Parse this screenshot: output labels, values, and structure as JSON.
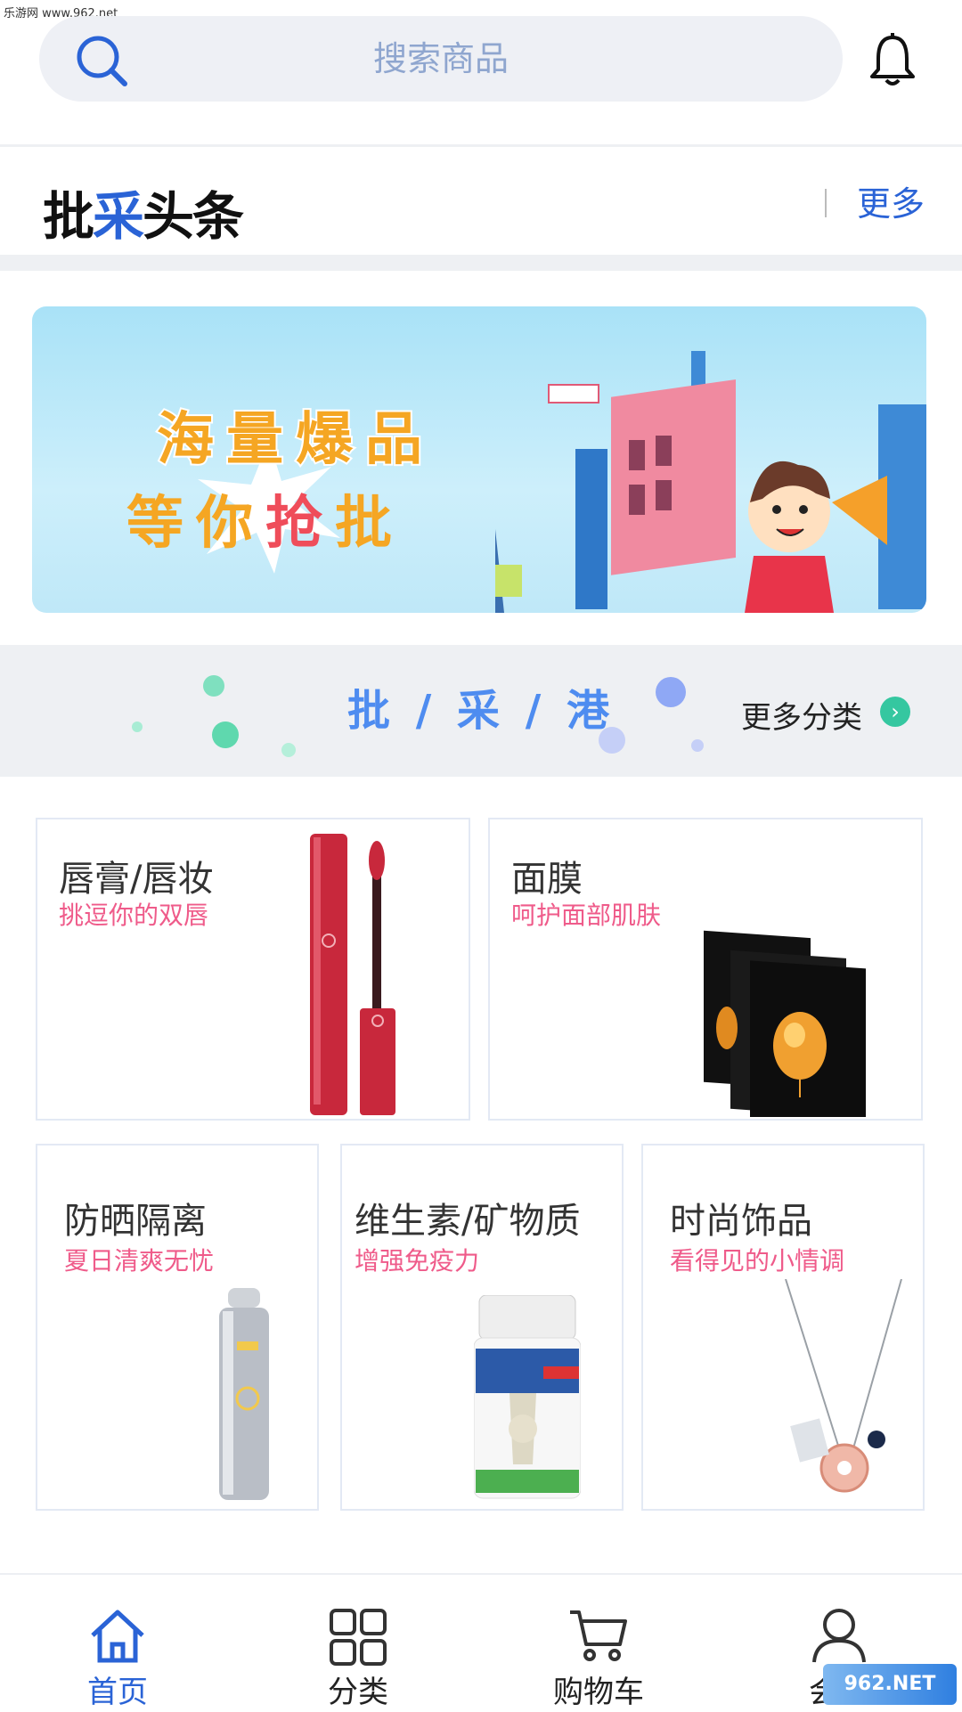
{
  "watermark_top": "乐游网 www.962.net",
  "search": {
    "placeholder": "搜索商品"
  },
  "headline": {
    "part1": "批",
    "part2": "采",
    "part3": "头条",
    "more": "更多"
  },
  "banner": {
    "line1": "海量爆品",
    "line2a": "等你",
    "line2b": "抢",
    "line2c": "批"
  },
  "category_strip": {
    "title": "批 / 采 / 港",
    "more": "更多分类",
    "more_icon": "chevron-right-icon"
  },
  "categories": [
    {
      "title": "唇膏/唇妆",
      "subtitle": "挑逗你的双唇"
    },
    {
      "title": "面膜",
      "subtitle": "呵护面部肌肤"
    },
    {
      "title": "防晒隔离",
      "subtitle": "夏日清爽无忧"
    },
    {
      "title": "维生素/矿物质",
      "subtitle": "增强免疫力"
    },
    {
      "title": "时尚饰品",
      "subtitle": "看得见的小情调"
    }
  ],
  "nav": [
    {
      "label": "首页",
      "icon": "home-icon",
      "active": true
    },
    {
      "label": "分类",
      "icon": "grid-icon",
      "active": false
    },
    {
      "label": "购物车",
      "icon": "cart-icon",
      "active": false
    },
    {
      "label": "会员",
      "icon": "user-icon",
      "active": false
    }
  ],
  "watermark_bottom": "962.NET",
  "colors": {
    "accent": "#2a63d6",
    "pink": "#ef5b8a",
    "banner_bg": "#bfe8f8",
    "teal": "#35c7a0"
  }
}
